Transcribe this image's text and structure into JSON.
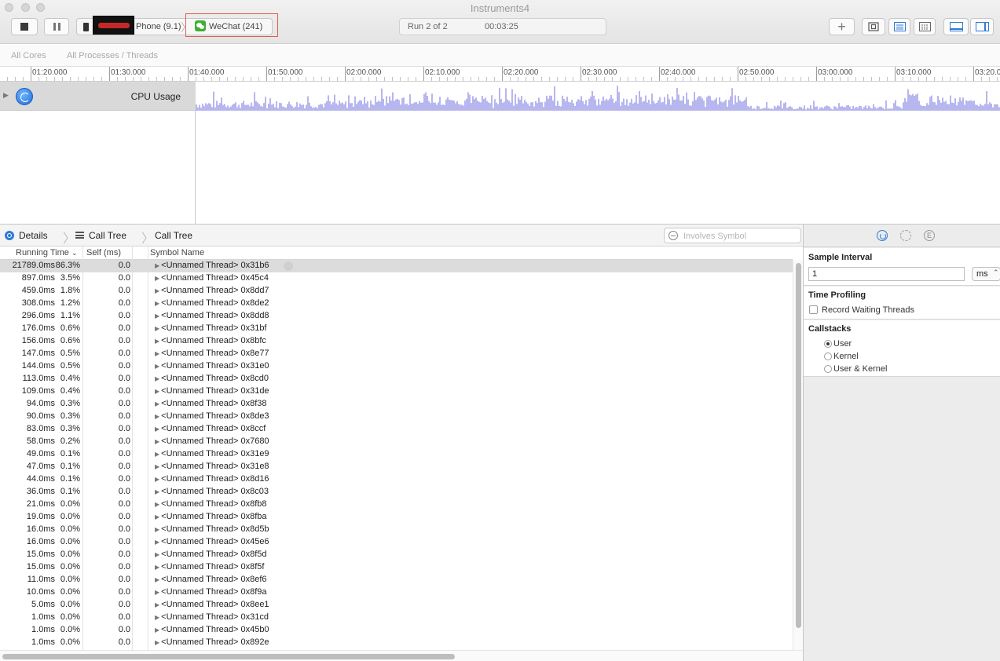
{
  "window": {
    "title": "Instruments4"
  },
  "toolbar": {
    "device_label": "Phone (9.1)",
    "app_label": "WeChat (241)",
    "run_label": "Run 2 of 2",
    "run_time": "00:03:25",
    "plus_label": "+"
  },
  "scope": {
    "cores": "All Cores",
    "processes": "All Processes / Threads"
  },
  "timeline": {
    "labels": [
      "01:20.000",
      "01:30.000",
      "01:40.000",
      "01:50.000",
      "02:00.000",
      "02:10.000",
      "02:20.000",
      "02:30.000",
      "02:40.000",
      "02:50.000",
      "03:00.000",
      "03:10.000",
      "03:20.0"
    ]
  },
  "track": {
    "label": "CPU Usage",
    "disclose": "▶",
    "graph_color": "#b7b6ef"
  },
  "detail": {
    "details_label": "Details",
    "crumb1": "Call Tree",
    "crumb2": "Call Tree",
    "search_placeholder": "Involves Symbol"
  },
  "table": {
    "headers": {
      "running_time": "Running Time",
      "sort": "⌄",
      "self": "Self (ms)",
      "symbol": "Symbol Name"
    },
    "rows": [
      {
        "time": "21789.0ms",
        "pct": "86.3%",
        "self": "0.0",
        "symbol": "<Unnamed Thread> 0x31b6"
      },
      {
        "time": "897.0ms",
        "pct": "3.5%",
        "self": "0.0",
        "symbol": "<Unnamed Thread> 0x45c4"
      },
      {
        "time": "459.0ms",
        "pct": "1.8%",
        "self": "0.0",
        "symbol": "<Unnamed Thread> 0x8dd7"
      },
      {
        "time": "308.0ms",
        "pct": "1.2%",
        "self": "0.0",
        "symbol": "<Unnamed Thread> 0x8de2"
      },
      {
        "time": "296.0ms",
        "pct": "1.1%",
        "self": "0.0",
        "symbol": "<Unnamed Thread> 0x8dd8"
      },
      {
        "time": "176.0ms",
        "pct": "0.6%",
        "self": "0.0",
        "symbol": "<Unnamed Thread> 0x31bf"
      },
      {
        "time": "156.0ms",
        "pct": "0.6%",
        "self": "0.0",
        "symbol": "<Unnamed Thread> 0x8bfc"
      },
      {
        "time": "147.0ms",
        "pct": "0.5%",
        "self": "0.0",
        "symbol": "<Unnamed Thread> 0x8e77"
      },
      {
        "time": "144.0ms",
        "pct": "0.5%",
        "self": "0.0",
        "symbol": "<Unnamed Thread> 0x31e0"
      },
      {
        "time": "113.0ms",
        "pct": "0.4%",
        "self": "0.0",
        "symbol": "<Unnamed Thread> 0x8cd0"
      },
      {
        "time": "109.0ms",
        "pct": "0.4%",
        "self": "0.0",
        "symbol": "<Unnamed Thread> 0x31de"
      },
      {
        "time": "94.0ms",
        "pct": "0.3%",
        "self": "0.0",
        "symbol": "<Unnamed Thread> 0x8f38"
      },
      {
        "time": "90.0ms",
        "pct": "0.3%",
        "self": "0.0",
        "symbol": "<Unnamed Thread> 0x8de3"
      },
      {
        "time": "83.0ms",
        "pct": "0.3%",
        "self": "0.0",
        "symbol": "<Unnamed Thread> 0x8ccf"
      },
      {
        "time": "58.0ms",
        "pct": "0.2%",
        "self": "0.0",
        "symbol": "<Unnamed Thread> 0x7680"
      },
      {
        "time": "49.0ms",
        "pct": "0.1%",
        "self": "0.0",
        "symbol": "<Unnamed Thread> 0x31e9"
      },
      {
        "time": "47.0ms",
        "pct": "0.1%",
        "self": "0.0",
        "symbol": "<Unnamed Thread> 0x31e8"
      },
      {
        "time": "44.0ms",
        "pct": "0.1%",
        "self": "0.0",
        "symbol": "<Unnamed Thread> 0x8d16"
      },
      {
        "time": "36.0ms",
        "pct": "0.1%",
        "self": "0.0",
        "symbol": "<Unnamed Thread> 0x8c03"
      },
      {
        "time": "21.0ms",
        "pct": "0.0%",
        "self": "0.0",
        "symbol": "<Unnamed Thread> 0x8fb8"
      },
      {
        "time": "19.0ms",
        "pct": "0.0%",
        "self": "0.0",
        "symbol": "<Unnamed Thread> 0x8fba"
      },
      {
        "time": "16.0ms",
        "pct": "0.0%",
        "self": "0.0",
        "symbol": "<Unnamed Thread> 0x8d5b"
      },
      {
        "time": "16.0ms",
        "pct": "0.0%",
        "self": "0.0",
        "symbol": "<Unnamed Thread> 0x45e6"
      },
      {
        "time": "15.0ms",
        "pct": "0.0%",
        "self": "0.0",
        "symbol": "<Unnamed Thread> 0x8f5d"
      },
      {
        "time": "15.0ms",
        "pct": "0.0%",
        "self": "0.0",
        "symbol": "<Unnamed Thread> 0x8f5f"
      },
      {
        "time": "11.0ms",
        "pct": "0.0%",
        "self": "0.0",
        "symbol": "<Unnamed Thread> 0x8ef6"
      },
      {
        "time": "10.0ms",
        "pct": "0.0%",
        "self": "0.0",
        "symbol": "<Unnamed Thread> 0x8f9a"
      },
      {
        "time": "5.0ms",
        "pct": "0.0%",
        "self": "0.0",
        "symbol": "<Unnamed Thread> 0x8ee1"
      },
      {
        "time": "1.0ms",
        "pct": "0.0%",
        "self": "0.0",
        "symbol": "<Unnamed Thread> 0x31cd"
      },
      {
        "time": "1.0ms",
        "pct": "0.0%",
        "self": "0.0",
        "symbol": "<Unnamed Thread> 0x45b0"
      },
      {
        "time": "1.0ms",
        "pct": "0.0%",
        "self": "0.0",
        "symbol": "<Unnamed Thread> 0x892e"
      }
    ]
  },
  "inspector": {
    "sample_interval_title": "Sample Interval",
    "sample_interval_value": "1",
    "unit": "ms",
    "unit_arrows": "⌃⌄",
    "time_profiling_title": "Time Profiling",
    "record_waiting_label": "Record Waiting Threads",
    "callstacks_title": "Callstacks",
    "callstack_options": [
      "User",
      "Kernel",
      "User & Kernel"
    ],
    "callstack_selected": "User",
    "e_icon_glyph": "E"
  },
  "icons": {
    "accent": "#2f7bd6",
    "wechat_green": "#3cb034",
    "highlight_red": "#e25a4f"
  }
}
